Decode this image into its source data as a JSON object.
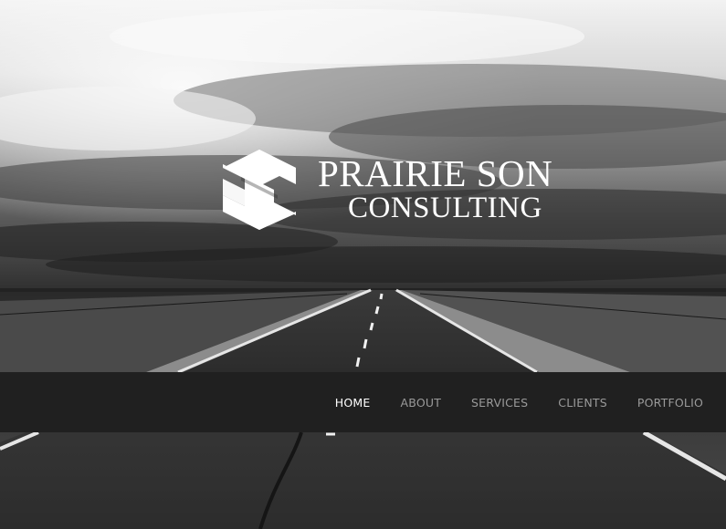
{
  "brand": {
    "title": "PRAIRIE SON",
    "subtitle": "CONSULTING",
    "logo_icon": "stylized-s-logo"
  },
  "nav": {
    "items": [
      {
        "label": "HOME",
        "active": true
      },
      {
        "label": "ABOUT",
        "active": false
      },
      {
        "label": "SERVICES",
        "active": false
      },
      {
        "label": "CLIENTS",
        "active": false
      },
      {
        "label": "PORTFOLIO",
        "active": false
      }
    ]
  },
  "colors": {
    "navbar_bg": "#202020",
    "nav_active": "#ffffff",
    "nav_inactive": "#9a9a9a"
  }
}
